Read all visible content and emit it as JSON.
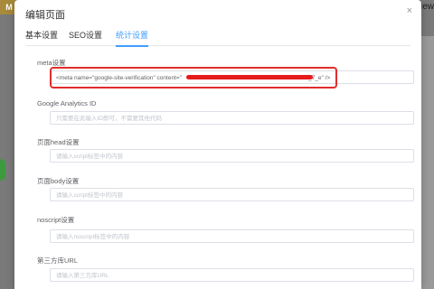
{
  "background": {
    "logo_text": "M",
    "corner_text": "New"
  },
  "modal": {
    "title": "编辑页面",
    "close_glyph": "×",
    "tabs": [
      {
        "label": "基本设置"
      },
      {
        "label": "SEO设置"
      },
      {
        "label": "统计设置",
        "active": true
      }
    ],
    "fields": {
      "meta": {
        "label": "meta设置",
        "value_start": "<meta name=\"google-site-verification\" content=\"",
        "value_end": "_7_e\" />"
      },
      "ga": {
        "label": "Google Analytics ID",
        "placeholder": "只需要在此输入ID即可，不需要其他代码"
      },
      "head": {
        "label": "页面head设置",
        "placeholder": "请输入script标签中的内容"
      },
      "body": {
        "label": "页面body设置",
        "placeholder": "请输入script标签中的内容"
      },
      "noscript": {
        "label": "noscript设置",
        "placeholder": "请输入noscript标签中的内容"
      },
      "third": {
        "label": "第三方库URL",
        "placeholder": "请输入第三方库URL"
      }
    }
  },
  "colors": {
    "accent": "#409eff",
    "highlight": "#e02d2d"
  }
}
